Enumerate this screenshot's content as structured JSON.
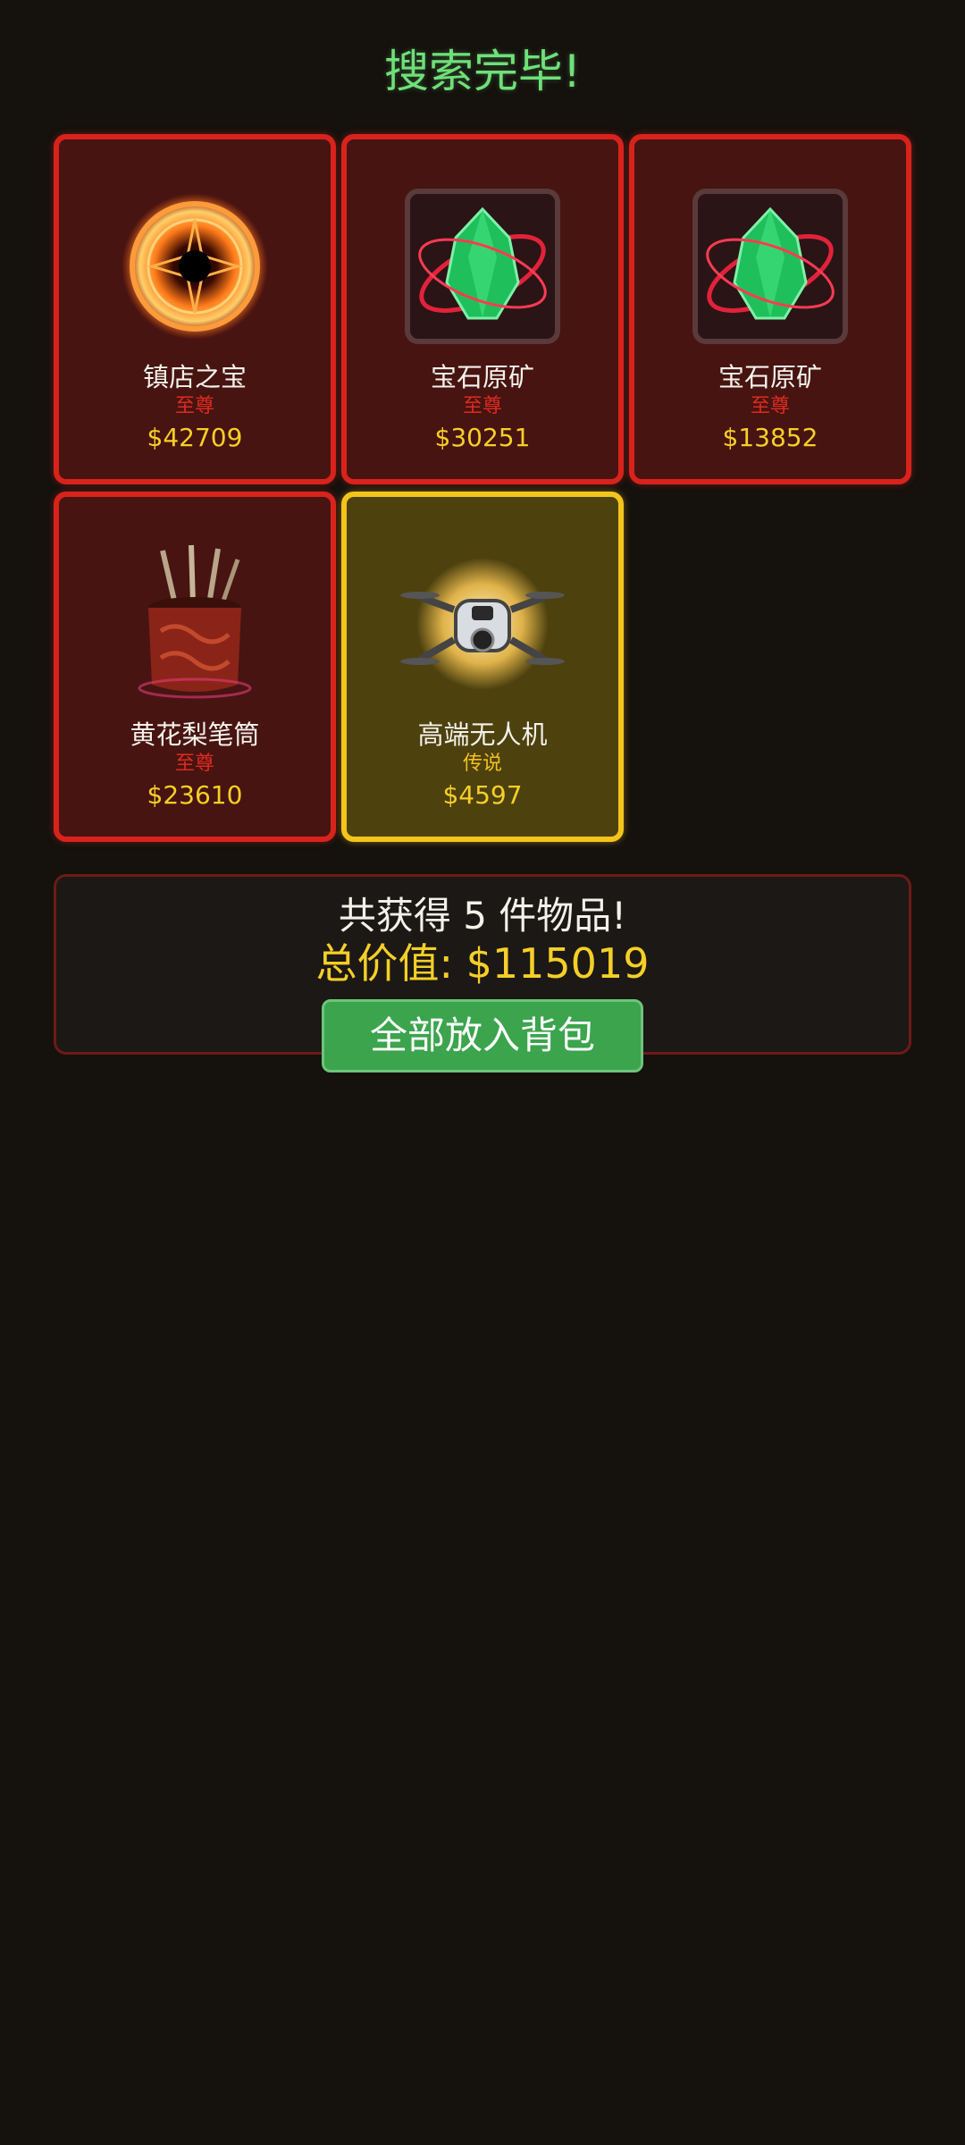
{
  "title": "搜索完毕!",
  "items": [
    {
      "name": "镇店之宝",
      "rarity": "至尊",
      "price": "$42709",
      "icon": "fire-ring-icon"
    },
    {
      "name": "宝石原矿",
      "rarity": "至尊",
      "price": "$30251",
      "icon": "gem-ore-icon"
    },
    {
      "name": "宝石原矿",
      "rarity": "至尊",
      "price": "$13852",
      "icon": "gem-ore-icon"
    },
    {
      "name": "黄花梨笔筒",
      "rarity": "至尊",
      "price": "$23610",
      "icon": "brush-pot-icon"
    },
    {
      "name": "高端无人机",
      "rarity": "传说",
      "price": "$4597",
      "icon": "drone-icon"
    }
  ],
  "summary": {
    "count_text": "共获得 5 件物品!",
    "total_text": "总价值: $115019"
  },
  "button": {
    "label": "全部放入背包"
  },
  "colors": {
    "supreme_border": "#d8231c",
    "legend_border": "#f3c51b",
    "price": "#f5cf27",
    "title": "#6fe07a",
    "button": "#3ba44d"
  }
}
